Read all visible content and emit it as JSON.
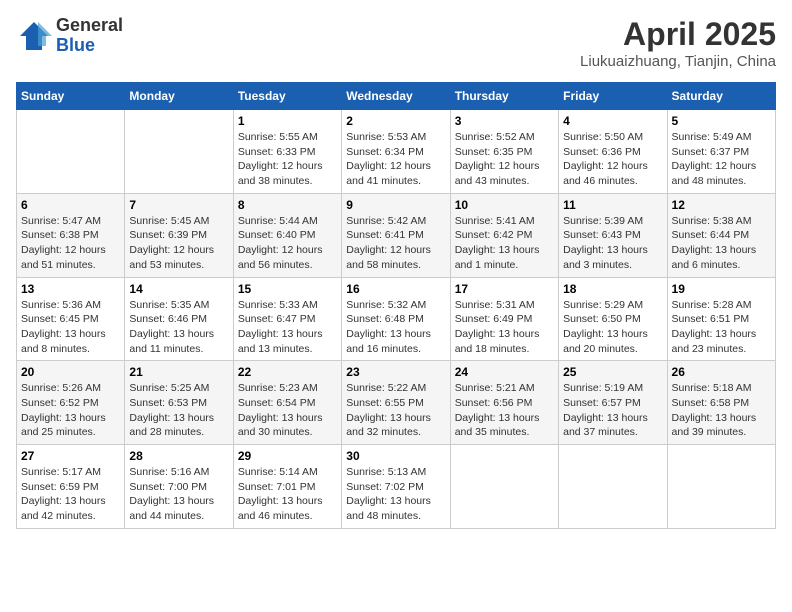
{
  "header": {
    "logo_general": "General",
    "logo_blue": "Blue",
    "month_title": "April 2025",
    "location": "Liukuaizhuang, Tianjin, China"
  },
  "weekdays": [
    "Sunday",
    "Monday",
    "Tuesday",
    "Wednesday",
    "Thursday",
    "Friday",
    "Saturday"
  ],
  "weeks": [
    [
      {
        "day": "",
        "info": ""
      },
      {
        "day": "",
        "info": ""
      },
      {
        "day": "1",
        "info": "Sunrise: 5:55 AM\nSunset: 6:33 PM\nDaylight: 12 hours and 38 minutes."
      },
      {
        "day": "2",
        "info": "Sunrise: 5:53 AM\nSunset: 6:34 PM\nDaylight: 12 hours and 41 minutes."
      },
      {
        "day": "3",
        "info": "Sunrise: 5:52 AM\nSunset: 6:35 PM\nDaylight: 12 hours and 43 minutes."
      },
      {
        "day": "4",
        "info": "Sunrise: 5:50 AM\nSunset: 6:36 PM\nDaylight: 12 hours and 46 minutes."
      },
      {
        "day": "5",
        "info": "Sunrise: 5:49 AM\nSunset: 6:37 PM\nDaylight: 12 hours and 48 minutes."
      }
    ],
    [
      {
        "day": "6",
        "info": "Sunrise: 5:47 AM\nSunset: 6:38 PM\nDaylight: 12 hours and 51 minutes."
      },
      {
        "day": "7",
        "info": "Sunrise: 5:45 AM\nSunset: 6:39 PM\nDaylight: 12 hours and 53 minutes."
      },
      {
        "day": "8",
        "info": "Sunrise: 5:44 AM\nSunset: 6:40 PM\nDaylight: 12 hours and 56 minutes."
      },
      {
        "day": "9",
        "info": "Sunrise: 5:42 AM\nSunset: 6:41 PM\nDaylight: 12 hours and 58 minutes."
      },
      {
        "day": "10",
        "info": "Sunrise: 5:41 AM\nSunset: 6:42 PM\nDaylight: 13 hours and 1 minute."
      },
      {
        "day": "11",
        "info": "Sunrise: 5:39 AM\nSunset: 6:43 PM\nDaylight: 13 hours and 3 minutes."
      },
      {
        "day": "12",
        "info": "Sunrise: 5:38 AM\nSunset: 6:44 PM\nDaylight: 13 hours and 6 minutes."
      }
    ],
    [
      {
        "day": "13",
        "info": "Sunrise: 5:36 AM\nSunset: 6:45 PM\nDaylight: 13 hours and 8 minutes."
      },
      {
        "day": "14",
        "info": "Sunrise: 5:35 AM\nSunset: 6:46 PM\nDaylight: 13 hours and 11 minutes."
      },
      {
        "day": "15",
        "info": "Sunrise: 5:33 AM\nSunset: 6:47 PM\nDaylight: 13 hours and 13 minutes."
      },
      {
        "day": "16",
        "info": "Sunrise: 5:32 AM\nSunset: 6:48 PM\nDaylight: 13 hours and 16 minutes."
      },
      {
        "day": "17",
        "info": "Sunrise: 5:31 AM\nSunset: 6:49 PM\nDaylight: 13 hours and 18 minutes."
      },
      {
        "day": "18",
        "info": "Sunrise: 5:29 AM\nSunset: 6:50 PM\nDaylight: 13 hours and 20 minutes."
      },
      {
        "day": "19",
        "info": "Sunrise: 5:28 AM\nSunset: 6:51 PM\nDaylight: 13 hours and 23 minutes."
      }
    ],
    [
      {
        "day": "20",
        "info": "Sunrise: 5:26 AM\nSunset: 6:52 PM\nDaylight: 13 hours and 25 minutes."
      },
      {
        "day": "21",
        "info": "Sunrise: 5:25 AM\nSunset: 6:53 PM\nDaylight: 13 hours and 28 minutes."
      },
      {
        "day": "22",
        "info": "Sunrise: 5:23 AM\nSunset: 6:54 PM\nDaylight: 13 hours and 30 minutes."
      },
      {
        "day": "23",
        "info": "Sunrise: 5:22 AM\nSunset: 6:55 PM\nDaylight: 13 hours and 32 minutes."
      },
      {
        "day": "24",
        "info": "Sunrise: 5:21 AM\nSunset: 6:56 PM\nDaylight: 13 hours and 35 minutes."
      },
      {
        "day": "25",
        "info": "Sunrise: 5:19 AM\nSunset: 6:57 PM\nDaylight: 13 hours and 37 minutes."
      },
      {
        "day": "26",
        "info": "Sunrise: 5:18 AM\nSunset: 6:58 PM\nDaylight: 13 hours and 39 minutes."
      }
    ],
    [
      {
        "day": "27",
        "info": "Sunrise: 5:17 AM\nSunset: 6:59 PM\nDaylight: 13 hours and 42 minutes."
      },
      {
        "day": "28",
        "info": "Sunrise: 5:16 AM\nSunset: 7:00 PM\nDaylight: 13 hours and 44 minutes."
      },
      {
        "day": "29",
        "info": "Sunrise: 5:14 AM\nSunset: 7:01 PM\nDaylight: 13 hours and 46 minutes."
      },
      {
        "day": "30",
        "info": "Sunrise: 5:13 AM\nSunset: 7:02 PM\nDaylight: 13 hours and 48 minutes."
      },
      {
        "day": "",
        "info": ""
      },
      {
        "day": "",
        "info": ""
      },
      {
        "day": "",
        "info": ""
      }
    ]
  ]
}
